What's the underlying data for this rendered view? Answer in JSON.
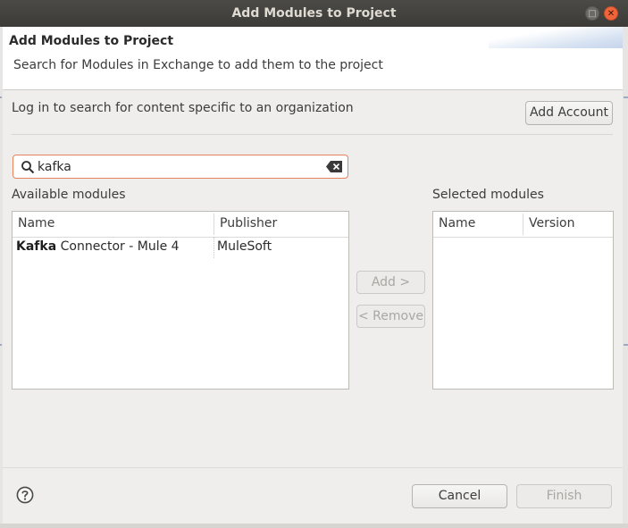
{
  "window": {
    "title": "Add Modules to Project",
    "maximize_glyph": "□",
    "close_glyph": "✕"
  },
  "banner": {
    "title": "Add Modules to Project",
    "subtitle": "Search for Modules in Exchange to add them to the project"
  },
  "login": {
    "message": "Log in to search for content specific to an organization",
    "add_account_label": "Add Account"
  },
  "search": {
    "value": "kafka",
    "icon": "search-icon",
    "clear_icon": "clear-icon"
  },
  "available": {
    "label": "Available modules",
    "columns": [
      "Name",
      "Publisher"
    ],
    "rows": [
      {
        "name_bold": "Kafka",
        "name_rest": " Connector - Mule 4",
        "publisher": "MuleSoft"
      }
    ]
  },
  "actions": {
    "add_label": "Add >",
    "remove_label": "< Remove"
  },
  "selected": {
    "label": "Selected modules",
    "columns": [
      "Name",
      "Version"
    ]
  },
  "footer": {
    "help_icon": "help-icon",
    "cancel_label": "Cancel",
    "finish_label": "Finish"
  },
  "colors": {
    "titlebar": "#3c3b37",
    "close_button": "#f0643a",
    "search_focus_border": "#e6835c",
    "dialog_background": "#efeeec"
  }
}
